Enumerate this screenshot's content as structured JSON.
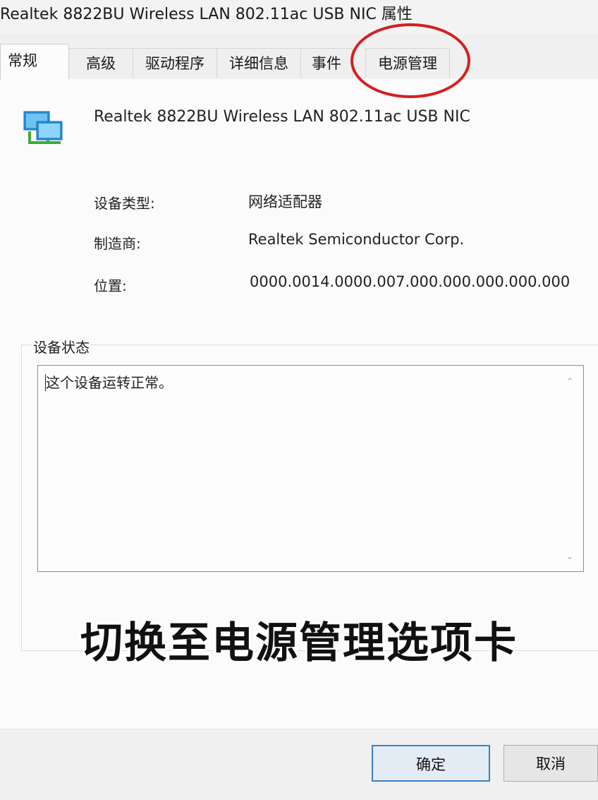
{
  "window": {
    "title": "Realtek 8822BU Wireless LAN 802.11ac USB NIC 属性"
  },
  "tabs": [
    {
      "label": "常规"
    },
    {
      "label": "高级"
    },
    {
      "label": "驱动程序"
    },
    {
      "label": "详细信息"
    },
    {
      "label": "事件"
    },
    {
      "label": "电源管理"
    }
  ],
  "general": {
    "device_name": "Realtek 8822BU Wireless LAN 802.11ac USB NIC",
    "device_icon": "network-adapter-icon",
    "properties": [
      {
        "label": "设备类型:",
        "value": "网络适配器"
      },
      {
        "label": "制造商:",
        "value": "Realtek Semiconductor Corp."
      },
      {
        "label": "位置:",
        "value": "0000.0014.0000.007.000.000.000.000.000"
      }
    ],
    "status_group_label": "设备状态",
    "status_text": "这个设备运转正常。"
  },
  "caption": "切换至电源管理选项卡",
  "buttons": {
    "ok": "确定",
    "cancel": "取消"
  },
  "colors": {
    "highlight_circle": "#d42020",
    "focus_border": "#5b9bd5"
  }
}
